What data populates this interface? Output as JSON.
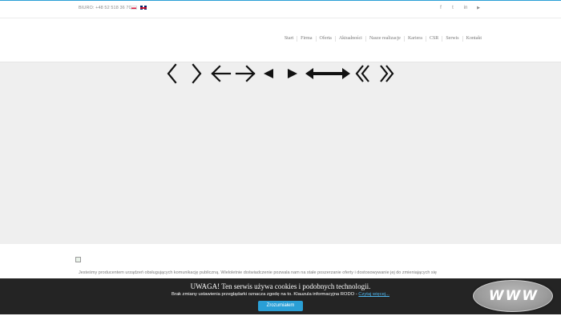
{
  "topbar": {
    "phone": "BIURO: +48 52 518 36 70",
    "flags": [
      "pl-flag-icon",
      "uk-flag-icon"
    ],
    "social_icons": [
      "facebook-icon",
      "twitter-icon",
      "linkedin-icon",
      "youtube-icon"
    ],
    "social_glyphs": [
      "f",
      "t",
      "in",
      "▶"
    ]
  },
  "nav": {
    "items": [
      "Start",
      "Firma",
      "Oferta",
      "Aktualności",
      "Nasze realizacje",
      "Kariera",
      "CSR",
      "Serwis",
      "Kontakt"
    ]
  },
  "slider": {
    "arrow_icons": [
      "chevron-left-icon",
      "chevron-right-icon",
      "arrow-left-icon",
      "arrow-right-icon",
      "triangle-left-icon",
      "triangle-right-icon",
      "bold-arrow-left-icon",
      "bold-arrow-right-icon",
      "double-chevron-left-icon",
      "double-chevron-right-icon"
    ]
  },
  "content": {
    "paragraph1": "Jesteśmy producentem urządzeń obsługujących komunikację publiczną. Wieloletnie doświadczenie pozwala nam na stałe poszerzanie oferty i dostosowywanie jej do zmieniających się",
    "image_icon": "broken-image-icon"
  },
  "cookie": {
    "title": "UWAGA! Ten serwis używa cookies i podobnych technologii.",
    "text": "Brak zmiany ustawienia przeglądarki oznacza zgodę na to. Klauzula informacyjna RODO - ",
    "link": "Czytaj więcej...",
    "button": "Zrozumiałem"
  },
  "badge": {
    "text": "WWW"
  },
  "colors": {
    "accent": "#2a9fd6",
    "slider_bg": "#efefef",
    "cookie_bg": "#151515"
  }
}
